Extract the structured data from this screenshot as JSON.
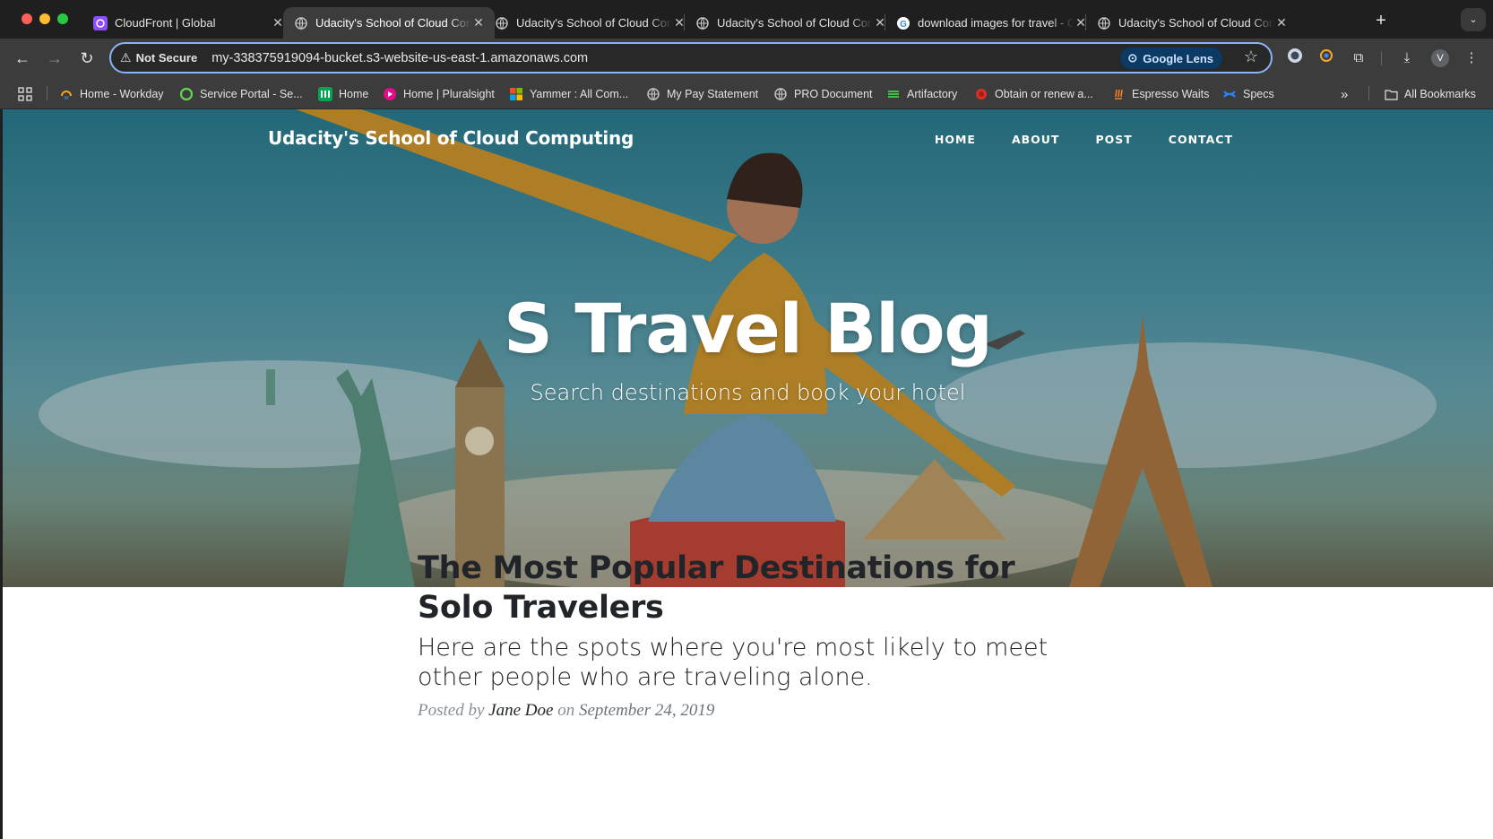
{
  "tabs": [
    {
      "title": "CloudFront | Global",
      "icon": "cloudfront-icon",
      "active": false
    },
    {
      "title": "Udacity's School of Cloud Computing",
      "icon": "globe-icon",
      "active": true
    },
    {
      "title": "Udacity's School of Cloud Computing",
      "icon": "globe-icon",
      "active": false
    },
    {
      "title": "Udacity's School of Cloud Computing",
      "icon": "globe-icon",
      "active": false
    },
    {
      "title": "download images for travel - Google Search",
      "icon": "google-icon",
      "active": false
    },
    {
      "title": "Udacity's School of Cloud Computing",
      "icon": "globe-icon",
      "active": false
    }
  ],
  "omnibox": {
    "security_label": "Not Secure",
    "url": "my-338375919094-bucket.s3-website-us-east-1.amazonaws.com",
    "lens_label": "Google Lens"
  },
  "profile_initial": "V",
  "bookmarks": [
    {
      "label": "Home - Workday",
      "icon": "workday-icon",
      "color": "#f5a623"
    },
    {
      "label": "Service Portal - Se...",
      "icon": "servicenow-icon",
      "color": "#62d84e"
    },
    {
      "label": "Home",
      "icon": "monday-icon",
      "color": "#00a650"
    },
    {
      "label": "Home | Pluralsight",
      "icon": "pluralsight-icon",
      "color": "#e80a89"
    },
    {
      "label": "Yammer : All Com...",
      "icon": "microsoft-icon",
      "color": "#f25022"
    },
    {
      "label": "My Pay Statement",
      "icon": "globe-icon",
      "color": "#9aa0a6"
    },
    {
      "label": "PRO Document",
      "icon": "globe-icon",
      "color": "#9aa0a6"
    },
    {
      "label": "Artifactory",
      "icon": "artifactory-icon",
      "color": "#40be46"
    },
    {
      "label": "Obtain or renew a...",
      "icon": "certificate-icon",
      "color": "#d93025"
    },
    {
      "label": "Espresso Waits",
      "icon": "espresso-icon",
      "color": "#f48024"
    },
    {
      "label": "Specs",
      "icon": "confluence-icon",
      "color": "#2684ff"
    }
  ],
  "all_bookmarks_label": "All Bookmarks",
  "site": {
    "brand": "Udacity's School of Cloud Computing",
    "nav": [
      "HOME",
      "ABOUT",
      "POST",
      "CONTACT"
    ],
    "hero_title": "S Travel Blog",
    "hero_subtitle": "Search destinations and book your hotel"
  },
  "post": {
    "title": "The Most Popular Destinations for Solo Travelers",
    "subtitle": "Here are the spots where you're most likely to meet other people who are traveling alone.",
    "meta_prefix": "Posted by",
    "author": "Jane Doe",
    "meta_on": "on",
    "date": "September 24, 2019"
  }
}
